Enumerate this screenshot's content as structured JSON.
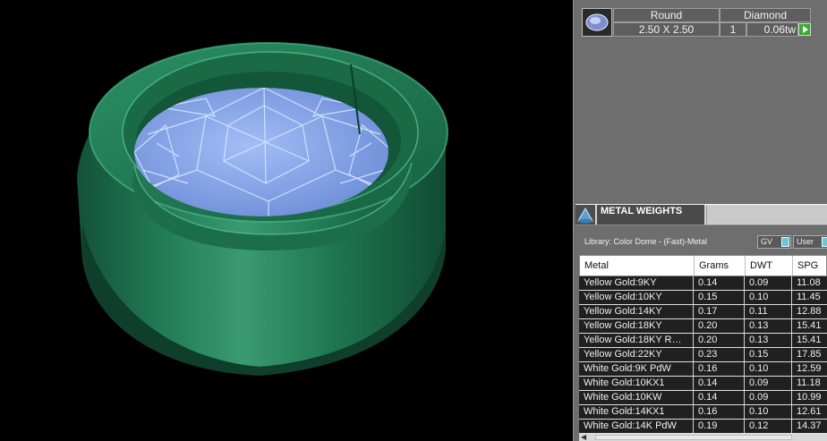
{
  "stone": {
    "shape": "Round",
    "type": "Diamond",
    "size": "2.50 X 2.50",
    "qty": "1",
    "weight": "0.06tw",
    "icon": "round-stone-icon",
    "play_icon": "play-icon"
  },
  "metal_weights": {
    "title": "METAL WEIGHTS",
    "icon": "dome-icon",
    "library": "Library: Color Dome - (Fast)-Metal",
    "gv_label": "GV",
    "user_label": "User",
    "columns": [
      "Metal",
      "Grams",
      "DWT",
      "SPG"
    ],
    "rows": [
      [
        "Yellow Gold:9KY",
        "0.14",
        "0.09",
        "11.08"
      ],
      [
        "Yellow Gold:10KY",
        "0.15",
        "0.10",
        "11.45"
      ],
      [
        "Yellow Gold:14KY",
        "0.17",
        "0.11",
        "12.88"
      ],
      [
        "Yellow Gold:18KY",
        "0.20",
        "0.13",
        "15.41"
      ],
      [
        "Yellow Gold:18KY R…",
        "0.20",
        "0.13",
        "15.41"
      ],
      [
        "Yellow Gold:22KY",
        "0.23",
        "0.15",
        "17.85"
      ],
      [
        "White Gold:9K PdW",
        "0.16",
        "0.10",
        "12.59"
      ],
      [
        "White Gold:10KX1",
        "0.14",
        "0.09",
        "11.18"
      ],
      [
        "White Gold:10KW",
        "0.14",
        "0.09",
        "10.99"
      ],
      [
        "White Gold:14KX1",
        "0.16",
        "0.10",
        "12.61"
      ],
      [
        "White Gold:14K PdW",
        "0.19",
        "0.12",
        "14.37"
      ]
    ]
  },
  "colors": {
    "metal_green": "#1f7a52",
    "stone_blue": "#7aa3f0",
    "panel_gray": "#6e6e6e",
    "accent_green": "#3aa835"
  }
}
